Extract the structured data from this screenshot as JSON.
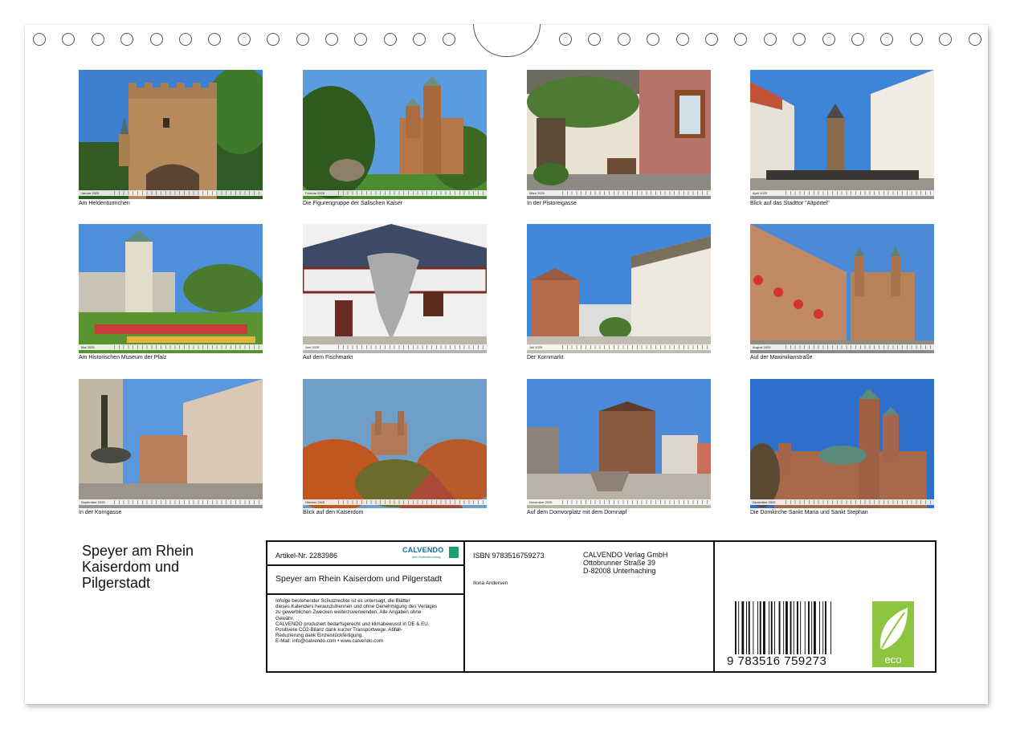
{
  "calendar": {
    "title": "Speyer am Rhein Kaiserdom und Pilgerstadt",
    "title_lines": [
      "Speyer am Rhein",
      "Kaiserdom und",
      "Pilgerstadt"
    ]
  },
  "months": [
    {
      "bar": "Januar 2025",
      "caption": "Am Heldentürmchen"
    },
    {
      "bar": "Februar 2025",
      "caption": "Die Figurengruppe der Salischen Kaiser"
    },
    {
      "bar": "März 2025",
      "caption": "In der Pistoreigasse"
    },
    {
      "bar": "April 2025",
      "caption": "Blick auf das Stadttor \"Altpörtel\""
    },
    {
      "bar": "Mai 2025",
      "caption": "Am Historischen Museum der Pfalz"
    },
    {
      "bar": "Juni 2025",
      "caption": "Auf dem Fischmarkt"
    },
    {
      "bar": "Juli 2025",
      "caption": "Der Kornmarkt"
    },
    {
      "bar": "August 2025",
      "caption": "Auf der Maximilianstraße"
    },
    {
      "bar": "September 2025",
      "caption": "In der Korngasse"
    },
    {
      "bar": "Oktober 2025",
      "caption": "Blick auf den Kaiserdom"
    },
    {
      "bar": "November 2025",
      "caption": "Auf dem Domvorplatz mit dem Domnapf"
    },
    {
      "bar": "Dezember 2025",
      "caption": "Die Domkirche Sankt Maria und Sankt Stephan"
    }
  ],
  "info": {
    "article": "Artikel-Nr. 2283986",
    "logo_word": "CALVENDO",
    "logo_sub": "dein Kalenderverlag",
    "title": "Speyer am Rhein Kaiserdom und Pilgerstadt",
    "legal_lines": [
      "Infolge bestehender Schutzrechte ist es untersagt, die Blätter",
      "dieses Kalenders herauszutrennen und ohne Genehmigung des Verlages",
      "zu gewerblichen Zwecken weiterzuverwenden. Alle Angaben ohne",
      "Gewähr.",
      "CALVENDO produziert bedarfsgerecht und klimabewusst in DE & EU.",
      "Positivere CO2-Bilanz dank kurzer Transportwege. Abfall-",
      "Reduzierung dank Einzelstückfertigung.",
      "E-Mail: info@calvendo.com • www.calvendo.com"
    ],
    "isbn": "ISBN 9783516759273",
    "author": "Ilona Andersen",
    "publisher_lines": [
      "CALVENDO Verlag GmbH",
      "Ottobrunner Straße 39",
      "D-82008 Unterhaching"
    ],
    "barcode_number": "9 783516 759273",
    "eco_label": "eco"
  },
  "colors": {
    "logo_blue": "#0b6fa8",
    "eco_green": "#8cc63f"
  }
}
